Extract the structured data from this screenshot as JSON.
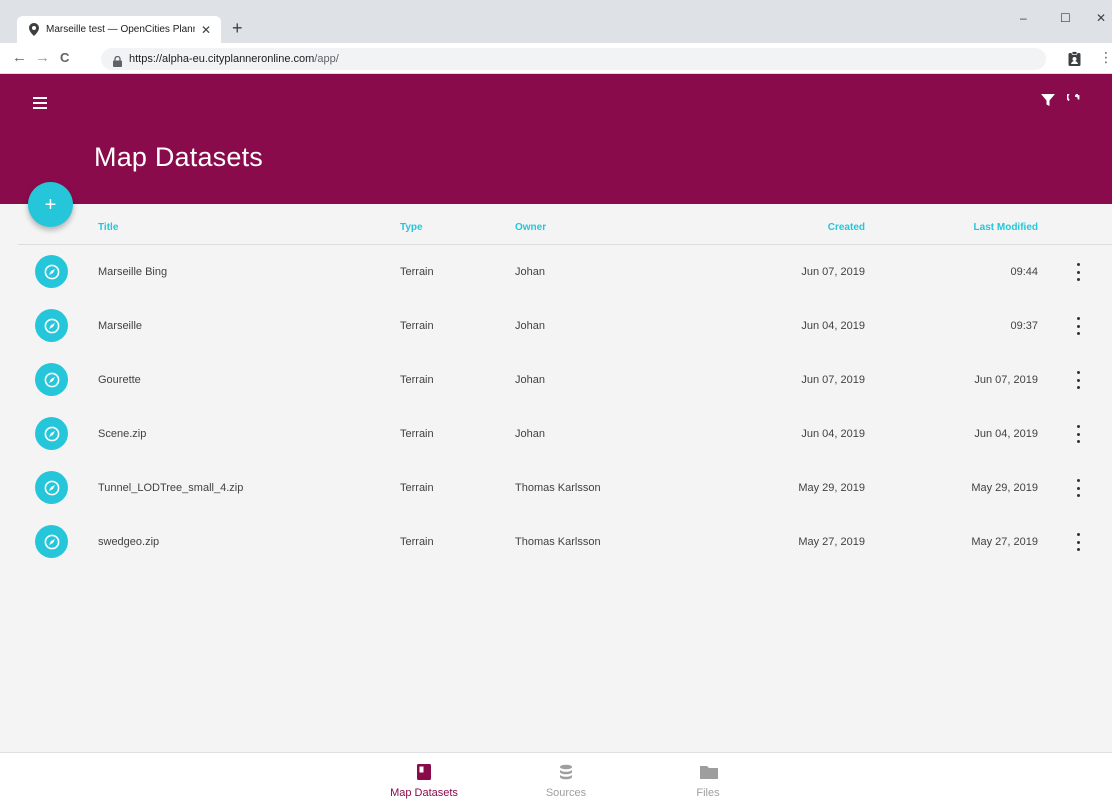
{
  "browser": {
    "tab_title": "Marseille test — OpenCities Plann",
    "tab_close": "✕",
    "new_tab": "+",
    "url_host": "https://alpha-eu.cityplanneronline.com",
    "url_path": "/app/",
    "back": "←",
    "forward": "→",
    "reload": "C",
    "menu": "⋮",
    "minimize": "–",
    "maximize": "☐",
    "close": "✕"
  },
  "header": {
    "title": "Map Datasets",
    "accent_color": "#8a0b4b"
  },
  "fab": {
    "label": "+",
    "color": "#26c6da"
  },
  "table": {
    "columns": {
      "title": "Title",
      "type": "Type",
      "owner": "Owner",
      "created": "Created",
      "modified": "Last Modified"
    },
    "rows": [
      {
        "title": "Marseille Bing",
        "type": "Terrain",
        "owner": "Johan",
        "created": "Jun 07, 2019",
        "modified": "09:44"
      },
      {
        "title": "Marseille",
        "type": "Terrain",
        "owner": "Johan",
        "created": "Jun 04, 2019",
        "modified": "09:37"
      },
      {
        "title": "Gourette",
        "type": "Terrain",
        "owner": "Johan",
        "created": "Jun 07, 2019",
        "modified": "Jun 07, 2019"
      },
      {
        "title": "Scene.zip",
        "type": "Terrain",
        "owner": "Johan",
        "created": "Jun 04, 2019",
        "modified": "Jun 04, 2019"
      },
      {
        "title": "Tunnel_LODTree_small_4.zip",
        "type": "Terrain",
        "owner": "Thomas Karlsson",
        "created": "May 29, 2019",
        "modified": "May 29, 2019"
      },
      {
        "title": "swedgeo.zip",
        "type": "Terrain",
        "owner": "Thomas Karlsson",
        "created": "May 27, 2019",
        "modified": "May 27, 2019"
      }
    ]
  },
  "bottom_nav": {
    "items": [
      {
        "label": "Map Datasets",
        "icon": "map-datasets-icon",
        "active": true
      },
      {
        "label": "Sources",
        "icon": "database-icon",
        "active": false
      },
      {
        "label": "Files",
        "icon": "folder-icon",
        "active": false
      }
    ]
  }
}
